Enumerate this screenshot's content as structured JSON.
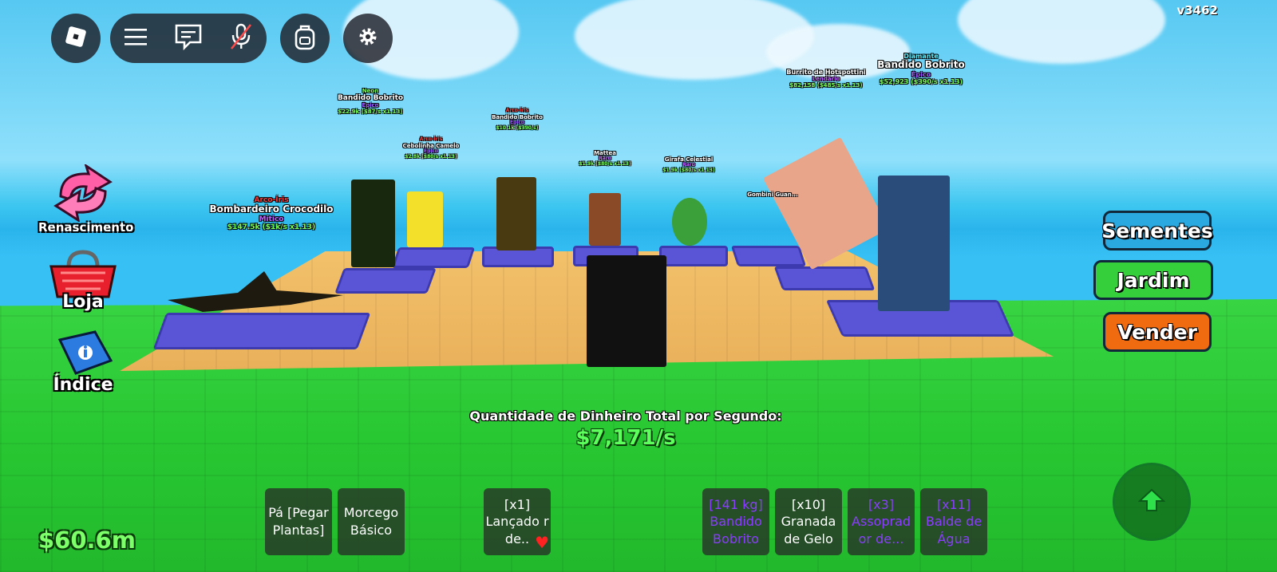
{
  "version": "v3462",
  "top_bar": {
    "roblox_icon": "roblox-logo-icon",
    "menu_icon": "hamburger-icon",
    "chat_icon": "chat-icon",
    "mic_icon": "mic-muted-icon",
    "backpack_icon": "backpack-icon",
    "settings_icon": "gear-icon"
  },
  "side_menu": {
    "rebirth": "Renascimento",
    "shop": "Loja",
    "index": "Índice"
  },
  "right_menu": {
    "seeds": "Sementes",
    "garden": "Jardim",
    "sell": "Vender"
  },
  "colors": {
    "seeds_bg": "#2aa8e0",
    "garden_bg": "#36cf3c",
    "sell_bg": "#f06a10"
  },
  "world_labels": [
    {
      "mut": "Arco-Íris",
      "name": "Bombardeiro Crocodilo",
      "rarity": "Mítico",
      "rate": "$147.5k ($1k/s x1.13)"
    },
    {
      "mut": "Neon",
      "name": "Bandido Bobrito",
      "rarity": "Épico",
      "rate": "$22.9k ($87/s x1.13)"
    },
    {
      "mut": "Arco-Íris",
      "name": "Cebolinha Camelo",
      "rarity": "Épico",
      "rate": "$2.8k ($80/s x1.13)"
    },
    {
      "mut": "Arco-Íris",
      "name": "Bandido Bobrito",
      "rarity": "Épico",
      "rate": "$10.1k ($390/s)"
    },
    {
      "mut": "",
      "name": "Mattea",
      "rarity": "Raro",
      "rate": "$1.9k ($80/s x1.13)"
    },
    {
      "mut": "",
      "name": "Girafa Celestial",
      "rarity": "Raro",
      "rate": "$1.9k ($80/s x1.13)"
    },
    {
      "mut": "",
      "name": "Gombini Guan...",
      "rarity": "",
      "rate": ""
    },
    {
      "mut": "",
      "name": "Burrito de Hotspottini",
      "rarity": "Lendário",
      "rate": "$82,158 ($485/s x1.13)"
    },
    {
      "mut": "Diamante",
      "name": "Bandido Bobrito",
      "rarity": "Épico",
      "rate": "$52,923 ($390/s x1.13)"
    }
  ],
  "total_money_label": "Quantidade de Dinheiro Total por Segundo:",
  "total_money_value": "$7,171/s",
  "cash": "$60.6m",
  "hotbar": [
    {
      "label": "Pá [Pegar Plantas]",
      "style": "white"
    },
    {
      "label": "Morcego Básico",
      "style": "white"
    },
    {
      "label": "[x1] Lançado r de..",
      "style": "white"
    },
    {
      "label": "[141 kg] Bandido Bobrito",
      "style": "purple"
    },
    {
      "label": "[x10] Granada de Gelo",
      "style": "white"
    },
    {
      "label": "[x3] Assoprad or de...",
      "style": "purple"
    },
    {
      "label": "[x11] Balde de Água",
      "style": "purple"
    }
  ],
  "jump_icon": "arrow-up-icon"
}
